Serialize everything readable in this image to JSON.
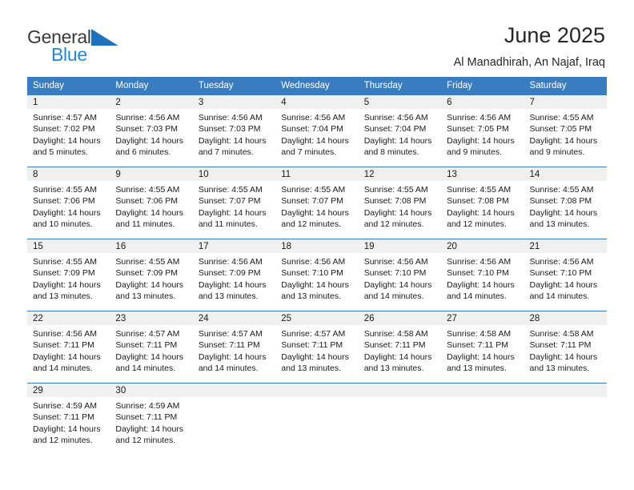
{
  "brand": {
    "name_part1": "General",
    "name_part2": "Blue",
    "triangle_icon": "triangle-icon",
    "colors": {
      "general": "#3a3a3a",
      "blue": "#1f8ad6",
      "triangle": "#1f71bb"
    }
  },
  "header": {
    "title": "June 2025",
    "subtitle": "Al Manadhirah, An Najaf, Iraq"
  },
  "calendar": {
    "accent_color": "#3a7cc0",
    "daynum_band_color": "#f0f0f0",
    "weekday_headers": [
      "Sunday",
      "Monday",
      "Tuesday",
      "Wednesday",
      "Thursday",
      "Friday",
      "Saturday"
    ],
    "weeks": [
      [
        {
          "day": "1",
          "sunrise": "Sunrise: 4:57 AM",
          "sunset": "Sunset: 7:02 PM",
          "daylight1": "Daylight: 14 hours",
          "daylight2": "and 5 minutes."
        },
        {
          "day": "2",
          "sunrise": "Sunrise: 4:56 AM",
          "sunset": "Sunset: 7:03 PM",
          "daylight1": "Daylight: 14 hours",
          "daylight2": "and 6 minutes."
        },
        {
          "day": "3",
          "sunrise": "Sunrise: 4:56 AM",
          "sunset": "Sunset: 7:03 PM",
          "daylight1": "Daylight: 14 hours",
          "daylight2": "and 7 minutes."
        },
        {
          "day": "4",
          "sunrise": "Sunrise: 4:56 AM",
          "sunset": "Sunset: 7:04 PM",
          "daylight1": "Daylight: 14 hours",
          "daylight2": "and 7 minutes."
        },
        {
          "day": "5",
          "sunrise": "Sunrise: 4:56 AM",
          "sunset": "Sunset: 7:04 PM",
          "daylight1": "Daylight: 14 hours",
          "daylight2": "and 8 minutes."
        },
        {
          "day": "6",
          "sunrise": "Sunrise: 4:56 AM",
          "sunset": "Sunset: 7:05 PM",
          "daylight1": "Daylight: 14 hours",
          "daylight2": "and 9 minutes."
        },
        {
          "day": "7",
          "sunrise": "Sunrise: 4:55 AM",
          "sunset": "Sunset: 7:05 PM",
          "daylight1": "Daylight: 14 hours",
          "daylight2": "and 9 minutes."
        }
      ],
      [
        {
          "day": "8",
          "sunrise": "Sunrise: 4:55 AM",
          "sunset": "Sunset: 7:06 PM",
          "daylight1": "Daylight: 14 hours",
          "daylight2": "and 10 minutes."
        },
        {
          "day": "9",
          "sunrise": "Sunrise: 4:55 AM",
          "sunset": "Sunset: 7:06 PM",
          "daylight1": "Daylight: 14 hours",
          "daylight2": "and 11 minutes."
        },
        {
          "day": "10",
          "sunrise": "Sunrise: 4:55 AM",
          "sunset": "Sunset: 7:07 PM",
          "daylight1": "Daylight: 14 hours",
          "daylight2": "and 11 minutes."
        },
        {
          "day": "11",
          "sunrise": "Sunrise: 4:55 AM",
          "sunset": "Sunset: 7:07 PM",
          "daylight1": "Daylight: 14 hours",
          "daylight2": "and 12 minutes."
        },
        {
          "day": "12",
          "sunrise": "Sunrise: 4:55 AM",
          "sunset": "Sunset: 7:08 PM",
          "daylight1": "Daylight: 14 hours",
          "daylight2": "and 12 minutes."
        },
        {
          "day": "13",
          "sunrise": "Sunrise: 4:55 AM",
          "sunset": "Sunset: 7:08 PM",
          "daylight1": "Daylight: 14 hours",
          "daylight2": "and 12 minutes."
        },
        {
          "day": "14",
          "sunrise": "Sunrise: 4:55 AM",
          "sunset": "Sunset: 7:08 PM",
          "daylight1": "Daylight: 14 hours",
          "daylight2": "and 13 minutes."
        }
      ],
      [
        {
          "day": "15",
          "sunrise": "Sunrise: 4:55 AM",
          "sunset": "Sunset: 7:09 PM",
          "daylight1": "Daylight: 14 hours",
          "daylight2": "and 13 minutes."
        },
        {
          "day": "16",
          "sunrise": "Sunrise: 4:55 AM",
          "sunset": "Sunset: 7:09 PM",
          "daylight1": "Daylight: 14 hours",
          "daylight2": "and 13 minutes."
        },
        {
          "day": "17",
          "sunrise": "Sunrise: 4:56 AM",
          "sunset": "Sunset: 7:09 PM",
          "daylight1": "Daylight: 14 hours",
          "daylight2": "and 13 minutes."
        },
        {
          "day": "18",
          "sunrise": "Sunrise: 4:56 AM",
          "sunset": "Sunset: 7:10 PM",
          "daylight1": "Daylight: 14 hours",
          "daylight2": "and 13 minutes."
        },
        {
          "day": "19",
          "sunrise": "Sunrise: 4:56 AM",
          "sunset": "Sunset: 7:10 PM",
          "daylight1": "Daylight: 14 hours",
          "daylight2": "and 14 minutes."
        },
        {
          "day": "20",
          "sunrise": "Sunrise: 4:56 AM",
          "sunset": "Sunset: 7:10 PM",
          "daylight1": "Daylight: 14 hours",
          "daylight2": "and 14 minutes."
        },
        {
          "day": "21",
          "sunrise": "Sunrise: 4:56 AM",
          "sunset": "Sunset: 7:10 PM",
          "daylight1": "Daylight: 14 hours",
          "daylight2": "and 14 minutes."
        }
      ],
      [
        {
          "day": "22",
          "sunrise": "Sunrise: 4:56 AM",
          "sunset": "Sunset: 7:11 PM",
          "daylight1": "Daylight: 14 hours",
          "daylight2": "and 14 minutes."
        },
        {
          "day": "23",
          "sunrise": "Sunrise: 4:57 AM",
          "sunset": "Sunset: 7:11 PM",
          "daylight1": "Daylight: 14 hours",
          "daylight2": "and 14 minutes."
        },
        {
          "day": "24",
          "sunrise": "Sunrise: 4:57 AM",
          "sunset": "Sunset: 7:11 PM",
          "daylight1": "Daylight: 14 hours",
          "daylight2": "and 14 minutes."
        },
        {
          "day": "25",
          "sunrise": "Sunrise: 4:57 AM",
          "sunset": "Sunset: 7:11 PM",
          "daylight1": "Daylight: 14 hours",
          "daylight2": "and 13 minutes."
        },
        {
          "day": "26",
          "sunrise": "Sunrise: 4:58 AM",
          "sunset": "Sunset: 7:11 PM",
          "daylight1": "Daylight: 14 hours",
          "daylight2": "and 13 minutes."
        },
        {
          "day": "27",
          "sunrise": "Sunrise: 4:58 AM",
          "sunset": "Sunset: 7:11 PM",
          "daylight1": "Daylight: 14 hours",
          "daylight2": "and 13 minutes."
        },
        {
          "day": "28",
          "sunrise": "Sunrise: 4:58 AM",
          "sunset": "Sunset: 7:11 PM",
          "daylight1": "Daylight: 14 hours",
          "daylight2": "and 13 minutes."
        }
      ],
      [
        {
          "day": "29",
          "sunrise": "Sunrise: 4:59 AM",
          "sunset": "Sunset: 7:11 PM",
          "daylight1": "Daylight: 14 hours",
          "daylight2": "and 12 minutes."
        },
        {
          "day": "30",
          "sunrise": "Sunrise: 4:59 AM",
          "sunset": "Sunset: 7:11 PM",
          "daylight1": "Daylight: 14 hours",
          "daylight2": "and 12 minutes."
        },
        {
          "day": "",
          "sunrise": "",
          "sunset": "",
          "daylight1": "",
          "daylight2": ""
        },
        {
          "day": "",
          "sunrise": "",
          "sunset": "",
          "daylight1": "",
          "daylight2": ""
        },
        {
          "day": "",
          "sunrise": "",
          "sunset": "",
          "daylight1": "",
          "daylight2": ""
        },
        {
          "day": "",
          "sunrise": "",
          "sunset": "",
          "daylight1": "",
          "daylight2": ""
        },
        {
          "day": "",
          "sunrise": "",
          "sunset": "",
          "daylight1": "",
          "daylight2": ""
        }
      ]
    ]
  }
}
